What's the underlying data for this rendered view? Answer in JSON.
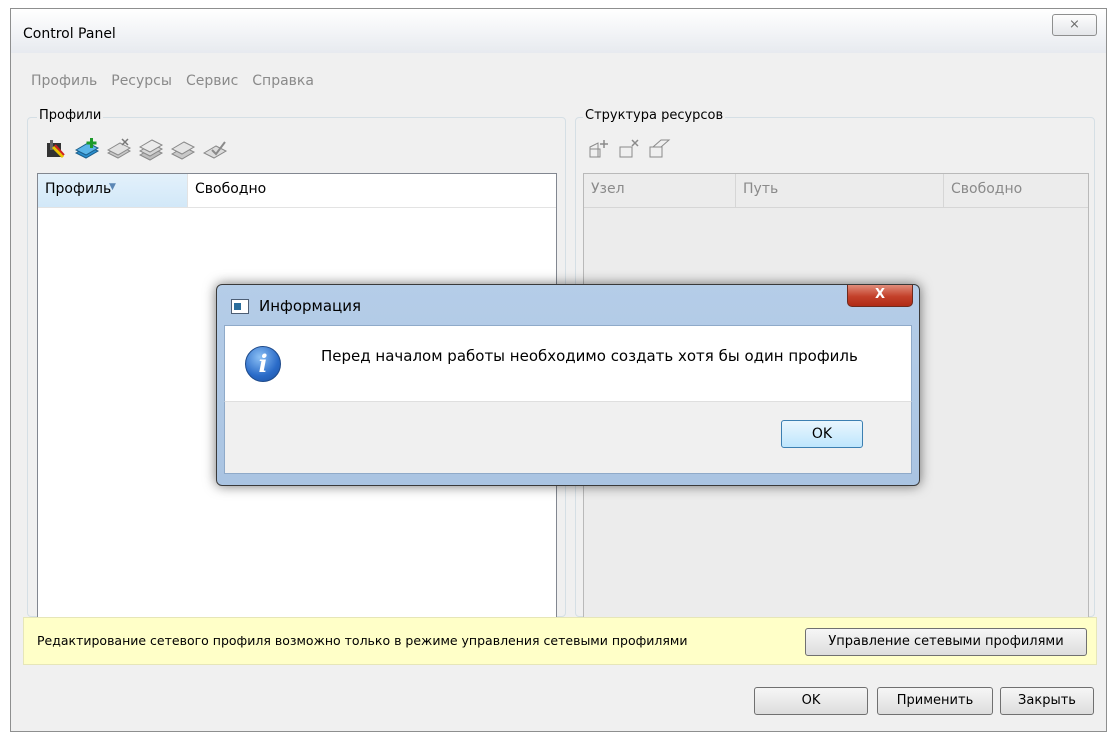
{
  "window": {
    "title": "Control Panel",
    "close_glyph": "⨯"
  },
  "menu": [
    "Профиль",
    "Ресурсы",
    "Сервис",
    "Справка"
  ],
  "profiles": {
    "group_label": "Профили",
    "toolbar_icons": [
      "profile-settings-icon",
      "add-profile-icon",
      "delete-profile-icon",
      "copy-profile-icon",
      "edit-profile-icon",
      "check-profile-icon"
    ],
    "columns": [
      "Профиль",
      "Свободно"
    ],
    "rows": []
  },
  "resources": {
    "group_label": "Структура ресурсов",
    "toolbar_icons": [
      "add-node-icon",
      "delete-node-icon",
      "edit-node-icon"
    ],
    "columns": [
      "Узел",
      "Путь",
      "Свободно"
    ],
    "rows": []
  },
  "infobar": {
    "message": "Редактирование сетевого профиля возможно только в режиме управления сетевыми профилями",
    "button": "Управление сетевыми профилями"
  },
  "footer": {
    "ok": "OK",
    "apply": "Применить",
    "close": "Закрыть"
  },
  "dialog": {
    "title": "Информация",
    "close_glyph": "X",
    "message": "Перед началом работы необходимо создать хотя бы один профиль",
    "ok": "OK"
  }
}
